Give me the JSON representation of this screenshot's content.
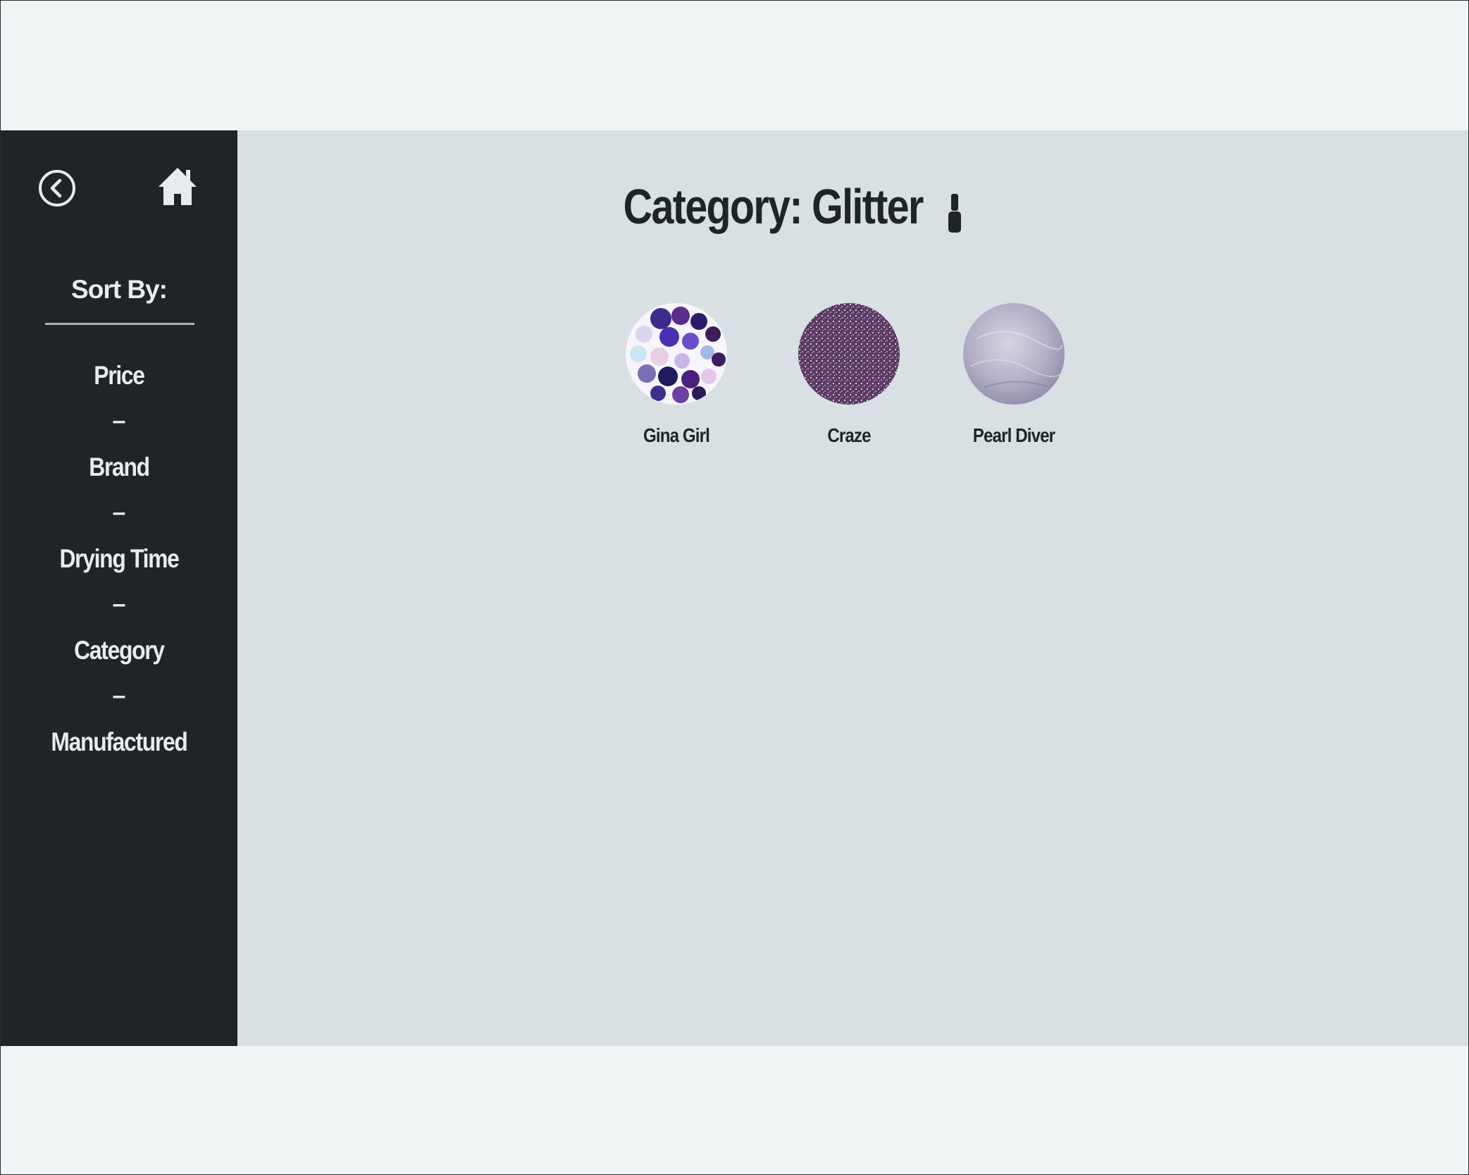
{
  "sidebar": {
    "icons": {
      "back": "back-circle-arrow-icon",
      "home": "home-icon"
    },
    "sort_title": "Sort By:",
    "items": [
      {
        "label": "Price"
      },
      {
        "label": "Brand"
      },
      {
        "label": "Drying Time"
      },
      {
        "label": "Category"
      },
      {
        "label": "Manufactured"
      }
    ],
    "separator": "–"
  },
  "main": {
    "title": "Category: Glitter",
    "title_icon": "nail-polish-icon",
    "products": [
      {
        "name": "Gina Girl",
        "swatch": "multicolor-purple-glitter"
      },
      {
        "name": "Craze",
        "swatch": "plum-fine-glitter"
      },
      {
        "name": "Pearl Diver",
        "swatch": "silver-lavender-shimmer"
      }
    ]
  },
  "colors": {
    "page_bg": "#f0f4f5",
    "sidebar_bg": "#202427",
    "main_bg": "#d8e0e3",
    "text_dark": "#1f2427",
    "text_light": "#e6ecee"
  }
}
